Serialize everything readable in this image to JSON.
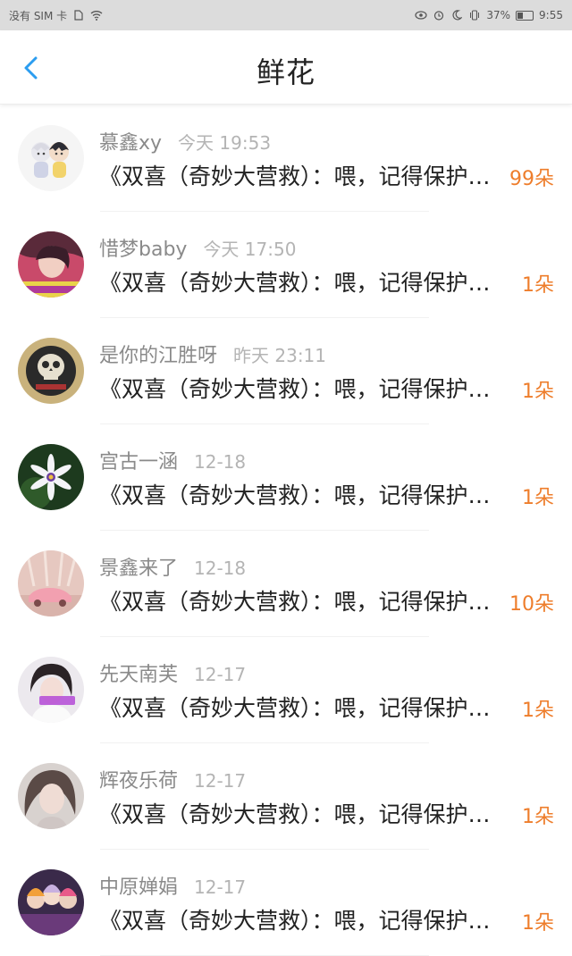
{
  "status_bar": {
    "carrier": "没有 SIM 卡",
    "battery_percent": "37%",
    "time": "9:55",
    "icons": [
      "sim-card-icon",
      "wifi-icon",
      "eye-icon",
      "alarm-icon",
      "moon-icon",
      "vibrate-icon",
      "battery-icon"
    ]
  },
  "header": {
    "title": "鲜花",
    "back_icon": "chevron-left-icon",
    "accent_color": "#2b9df0"
  },
  "count_color": "#ee7d2b",
  "items": [
    {
      "name": "慕鑫xy",
      "time": "今天 19:53",
      "message": "《双喜（奇妙大营救）：喂，记得保护好自己",
      "count": "99朵",
      "avatar": "anime-couple-avatar"
    },
    {
      "name": "惜梦baby",
      "time": "今天 17:50",
      "message": "《双喜（奇妙大营救）：喂，记得保护好自己",
      "count": "1朵",
      "avatar": "girl-photo-avatar"
    },
    {
      "name": "是你的江胜呀",
      "time": "昨天 23:11",
      "message": "《双喜（奇妙大营救）：喂，记得保护好自己",
      "count": "1朵",
      "avatar": "skull-logo-avatar"
    },
    {
      "name": "宫古一涵",
      "time": "12-18",
      "message": "《双喜（奇妙大营救）：喂，记得保护好自己",
      "count": "1朵",
      "avatar": "flower-avatar"
    },
    {
      "name": "景鑫来了",
      "time": "12-18",
      "message": "《双喜（奇妙大营救）：喂，记得保护好自己",
      "count": "10朵",
      "avatar": "pink-car-avatar"
    },
    {
      "name": "先天南芙",
      "time": "12-17",
      "message": "《双喜（奇妙大营救）：喂，记得保护好自己",
      "count": "1朵",
      "avatar": "softy-girl-avatar"
    },
    {
      "name": "辉夜乐荷",
      "time": "12-17",
      "message": "《双喜（奇妙大营救）：喂，记得保护好自己",
      "count": "1朵",
      "avatar": "girl-portrait-avatar"
    },
    {
      "name": "中原婵娟",
      "time": "12-17",
      "message": "《双喜（奇妙大营救）：喂，记得保护好自己",
      "count": "1朵",
      "avatar": "group-photo-avatar"
    }
  ]
}
